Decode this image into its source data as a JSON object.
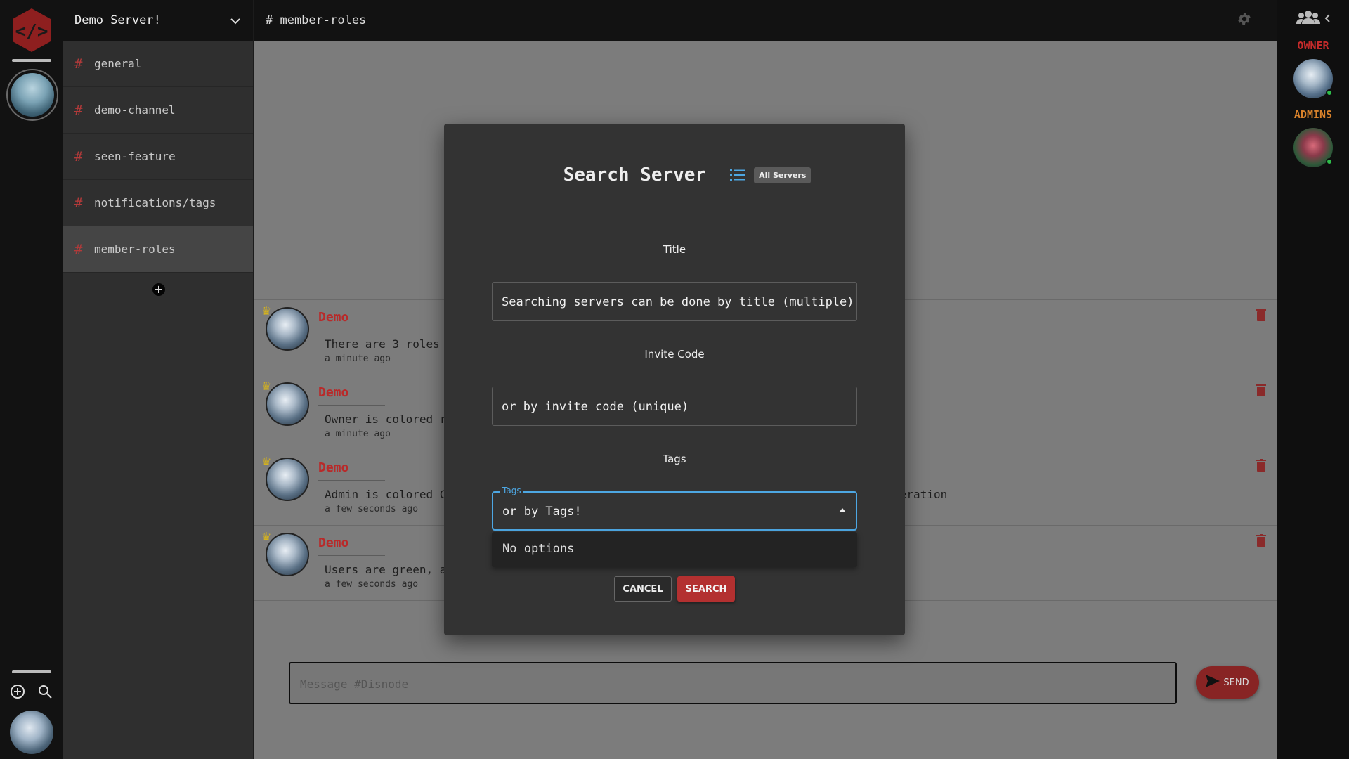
{
  "server": {
    "name": "Demo Server!"
  },
  "channels": [
    {
      "label": "general",
      "active": false
    },
    {
      "label": "demo-channel",
      "active": false
    },
    {
      "label": "seen-feature",
      "active": false
    },
    {
      "label": "notifications/tags",
      "active": false
    },
    {
      "label": "member-roles",
      "active": true
    }
  ],
  "add_channel_icon": "plus-circle-icon",
  "topbar": {
    "channel": "# member-roles",
    "settings_icon": "gear-icon"
  },
  "messages": [
    {
      "author": "Demo",
      "text": "There are 3 roles",
      "time": "a minute ago",
      "role": "owner"
    },
    {
      "author": "Demo",
      "text": "Owner is colored r",
      "time": "a minute ago",
      "role": "owner"
    },
    {
      "author": "Demo",
      "text": "Admin is colored C                                                            for moderation",
      "time": "a few seconds ago",
      "role": "owner"
    },
    {
      "author": "Demo",
      "text": "Users are green, a",
      "time": "a few seconds ago",
      "role": "owner"
    }
  ],
  "composer": {
    "placeholder": "Message #Disnode",
    "send_label": "SEND"
  },
  "members": {
    "header_icon": "group-icon",
    "roles": [
      {
        "label": "OWNER",
        "color": "#c62b2b"
      },
      {
        "label": "ADMINS",
        "color": "#d9822b"
      }
    ]
  },
  "modal": {
    "title": "Search Server",
    "list_icon": "list-icon",
    "badge": "All Servers",
    "title_label": "Title",
    "title_value": "Searching servers can be done by title (multiple)",
    "invite_label": "Invite Code",
    "invite_value": "or by invite code (unique)",
    "tags_label": "Tags",
    "tags_legend": "Tags",
    "tags_value": "or by Tags!",
    "no_options": "No options",
    "cancel": "CANCEL",
    "search": "SEARCH"
  },
  "colors": {
    "accent_red": "#b33030",
    "focus_blue": "#4da7e3",
    "online_green": "#2ebd4a"
  }
}
